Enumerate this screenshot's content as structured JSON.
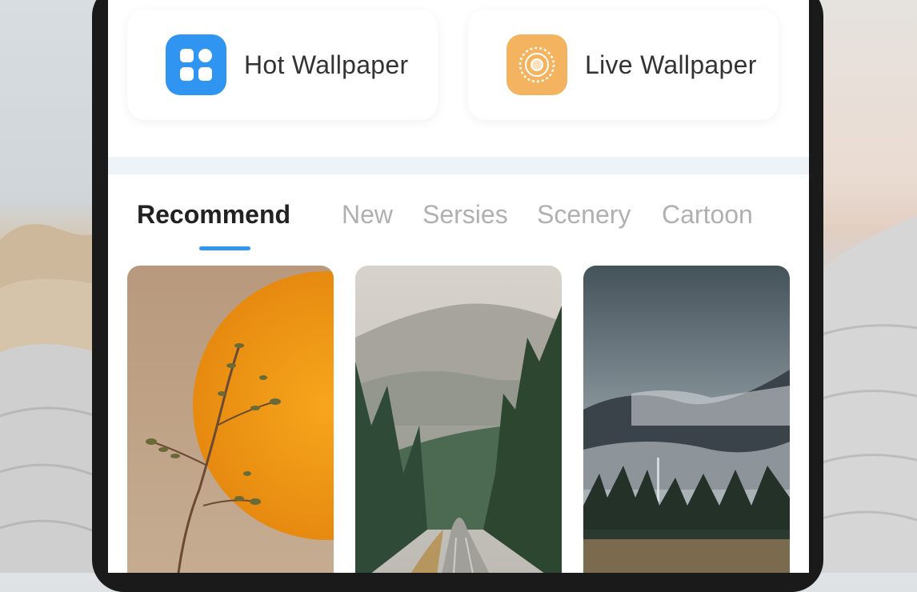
{
  "quick_actions": [
    {
      "label": "Hot Wallpaper",
      "icon": "grid-apps-icon",
      "color": "#2f95f1"
    },
    {
      "label": "Live Wallpaper",
      "icon": "sun-ring-icon",
      "color": "#f4b45f"
    }
  ],
  "tabs": [
    {
      "label": "Recommend",
      "active": true
    },
    {
      "label": "New",
      "active": false
    },
    {
      "label": "Sersies",
      "active": false
    },
    {
      "label": "Scenery",
      "active": false
    },
    {
      "label": "Cartoon",
      "active": false
    }
  ],
  "accent_color": "#2f95f1",
  "wallpapers": [
    {
      "name": "orange-moon-branch"
    },
    {
      "name": "misty-forest-road"
    },
    {
      "name": "foggy-mountains"
    }
  ]
}
